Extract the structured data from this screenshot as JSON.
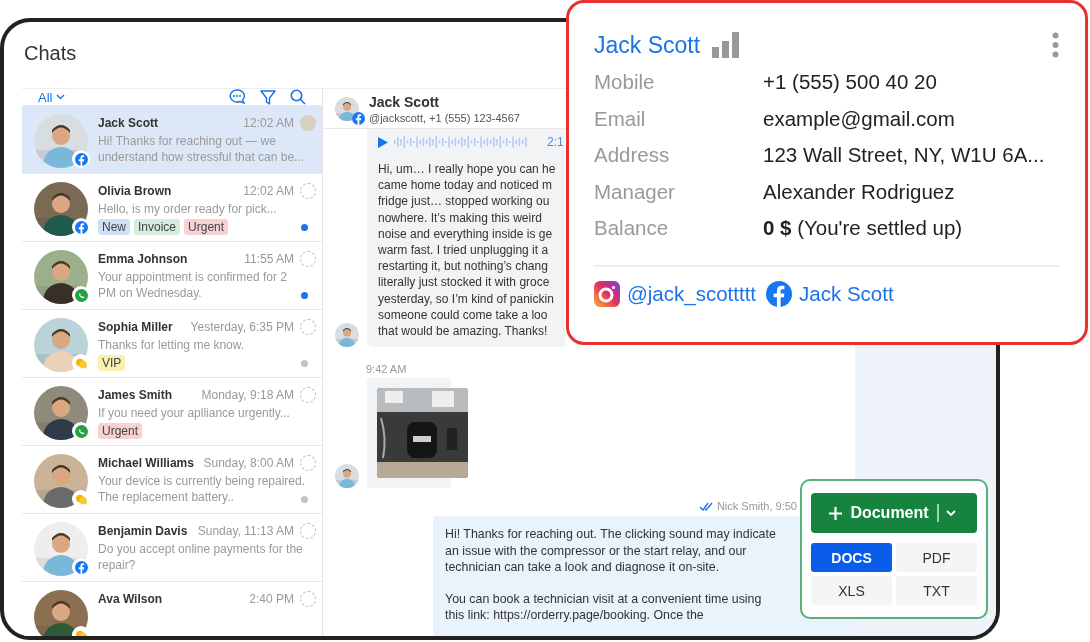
{
  "title": "Chats",
  "toolbar": {
    "filter": "All"
  },
  "chats": [
    {
      "name": "Jack Scott",
      "time": "12:02 AM",
      "preview": "Hi! Thanks for reaching out — we understand how stressful that can be...",
      "channel": {
        "kind": "facebook"
      },
      "selected": true,
      "assigned": true
    },
    {
      "name": "Olivia Brown",
      "time": "12:02 AM",
      "preview": "Hello, is my order ready for pick...",
      "channel": {
        "kind": "facebook"
      },
      "selected": false,
      "assigned": false,
      "status_dot": {
        "color": "#1a73e8"
      },
      "tags": [
        {
          "label": "New",
          "color": "#cfe0f7"
        },
        {
          "label": "Invoice",
          "color": "#d5eddc"
        },
        {
          "label": "Urgent",
          "color": "#f8d2d2"
        }
      ]
    },
    {
      "name": "Emma Johnson",
      "time": "11:55 AM",
      "preview": "Your appointment is confirmed for 2 PM on Wednesday.",
      "channel": {
        "kind": "whatsapp"
      },
      "selected": false,
      "assigned": false,
      "status_dot": {
        "color": "#1a73e8"
      }
    },
    {
      "name": "Sophia Miller",
      "time": "Yesterday, 6:35 PM",
      "preview": "Thanks for letting me know.",
      "channel": {
        "kind": "chat"
      },
      "selected": false,
      "assigned": false,
      "status_dot": {
        "color": "#c4c4c4"
      },
      "tags": [
        {
          "label": "VIP",
          "color": "#fbf0b0"
        }
      ]
    },
    {
      "name": "James Smith",
      "time": "Monday, 9:18 AM",
      "preview": "If you need your aplliance urgently...",
      "channel": {
        "kind": "whatsapp"
      },
      "selected": false,
      "assigned": false,
      "tags": [
        {
          "label": "Urgent",
          "color": "#f8d2d2"
        }
      ]
    },
    {
      "name": "Michael Williams",
      "time": "Sunday, 8:00 AM",
      "preview": "Your device is currently being repaired. The replacement battery..",
      "channel": {
        "kind": "chat"
      },
      "selected": false,
      "assigned": false,
      "status_dot": {
        "color": "#c4c4c4"
      }
    },
    {
      "name": "Benjamin Davis",
      "time": "Sunday, 11:13 AM",
      "preview": "Do you accept online payments for the repair?",
      "channel": {
        "kind": "facebook"
      },
      "selected": false,
      "assigned": false
    },
    {
      "name": "Ava Wilson",
      "time": "2:40 PM",
      "channel": {
        "kind": "chat"
      },
      "selected": false,
      "assigned": false
    }
  ],
  "conversation": {
    "name": "Jack Scott",
    "subtitle": "@jackscott, +1 (555) 123-4567",
    "messages": [
      {
        "kind": "voice",
        "duration": "2:1",
        "lines": [
          "Hi, um… I really hope you can he",
          "came home today and noticed m",
          "fridge just… stopped working ou",
          "nowhere. It’s making this weird",
          "noise and everything inside is ge",
          "warm fast. I tried unplugging it a",
          "restarting it, but nothing’s chang",
          "literally just stocked it with groce",
          "yesterday, so I’m kind of panickin",
          "someone could come take a loo",
          "that would be amazing. Thanks!"
        ]
      },
      {
        "time": "9:42 AM"
      },
      {
        "kind": "outgoing",
        "meta": "Nick Smith, 9:50",
        "read": true,
        "paragraphs": [
          "Hi! Thanks for reaching out. The clicking sound may indicate an issue with the compressor or the start relay, and our technician can take a look and diagnose it on-site.",
          "You can book a technician visit at a convenient time using this link: https://orderry.page/booking. Once the"
        ]
      }
    ]
  },
  "contact_card": {
    "name": "Jack Scott",
    "fields": [
      {
        "label": "Mobile",
        "value": "+1 (555) 500 40 20"
      },
      {
        "label": "Email",
        "value": "example@gmail.com"
      },
      {
        "label": "Address",
        "value": "123 Wall Street, NY, W1U 6A..."
      },
      {
        "label": "Manager",
        "value": "Alexander Rodriguez"
      },
      {
        "label": "Balance",
        "value": "**0 $** (You're settled up)"
      }
    ],
    "socials": [
      {
        "kind": "instagram",
        "label": "@jack_scottttt"
      },
      {
        "kind": "facebook",
        "label": "Jack Scott"
      }
    ]
  },
  "document_menu": {
    "button": "Document",
    "formats": [
      {
        "label": "DOCS",
        "selected": true
      },
      {
        "label": "PDF",
        "selected": false
      },
      {
        "label": "XLS",
        "selected": false
      },
      {
        "label": "TXT",
        "selected": false
      }
    ]
  }
}
